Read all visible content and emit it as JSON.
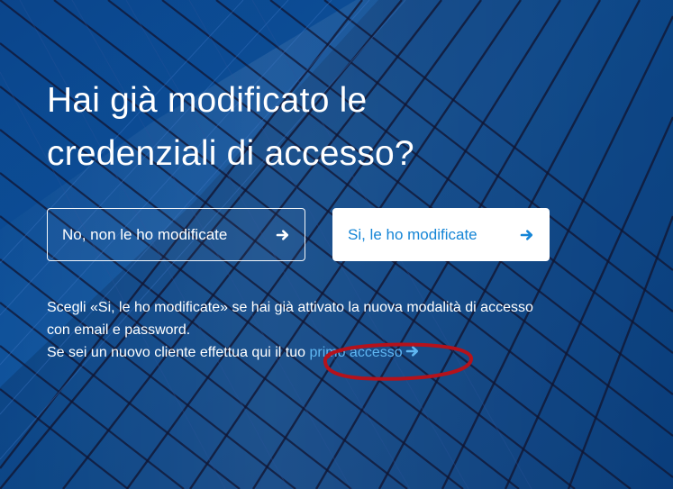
{
  "headline": "Hai già modificato le credenziali di accesso?",
  "buttons": {
    "no_label": "No, non le ho modificate",
    "yes_label": "Si, le ho modificate"
  },
  "info": {
    "line1": "Scegli «Si, le ho modificate» se hai già attivato la nuova modalità di accesso con email e password.",
    "line2_prefix": "Se sei un nuovo cliente effettua qui il tuo",
    "link_label": "primo accesso"
  },
  "icons": {
    "button_arrow": "arrow-right-icon",
    "link_arrow": "arrow-right-icon"
  },
  "colors": {
    "background": "#0b4f9a",
    "button_outline": "#ffffff",
    "button_fill": "#ffffff",
    "accent": "#1585d6",
    "link": "#5fb6f2",
    "annotation": "#b5121b"
  }
}
